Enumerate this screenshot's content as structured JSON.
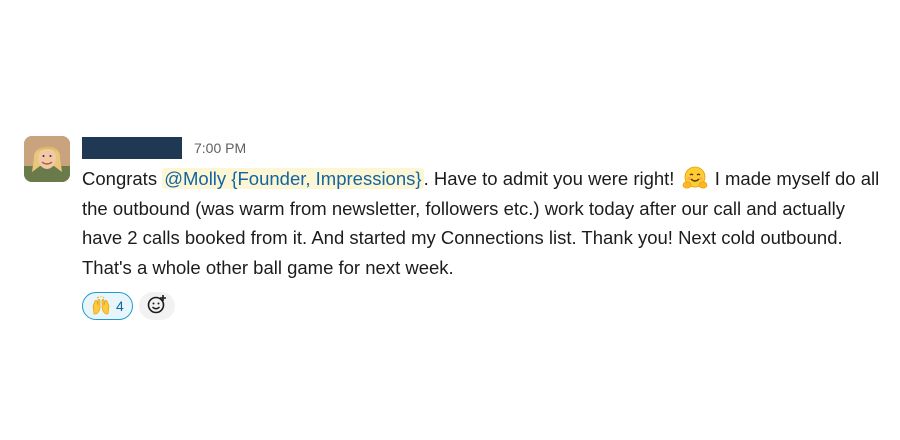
{
  "message": {
    "sender_name": "",
    "timestamp": "7:00 PM",
    "text_part1": "Congrats ",
    "mention": "@Molly {Founder, Impressions}",
    "text_part2": ". Have to admit you were right! ",
    "text_part3": " I made myself do all the outbound (was warm from newsletter, followers etc.) work today after our call and actually have 2 calls booked from it. And started my Connections list. Thank you! Next cold outbound. That's a whole other ball game for next week.",
    "inline_emoji": "hugging-face-icon"
  },
  "reactions": [
    {
      "emoji": "raised-hands-icon",
      "count": "4",
      "selected": true
    }
  ],
  "colors": {
    "mention_text": "#1264a3",
    "mention_bg": "#fdf6d4",
    "reaction_border": "#1d9bd1",
    "reaction_bg": "#e8f5fa",
    "sender_redaction": "#1f3853"
  }
}
